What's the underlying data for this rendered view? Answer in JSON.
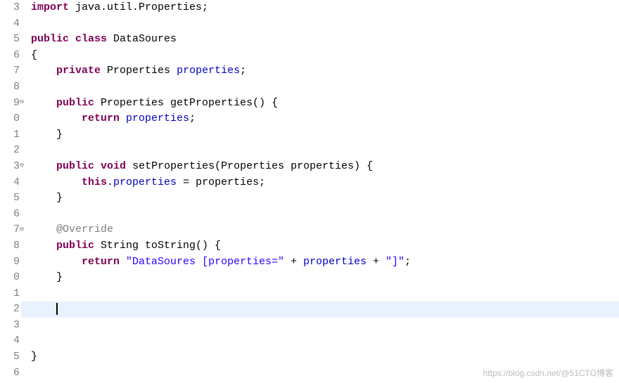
{
  "chart_data": null,
  "gutter": {
    "line_numbers": [
      "3",
      "4",
      "5",
      "6",
      "7",
      "8",
      "9",
      "0",
      "1",
      "2",
      "3",
      "4",
      "5",
      "6",
      "7",
      "8",
      "9",
      "0",
      "1",
      "2",
      "3",
      "4",
      "5",
      "6"
    ],
    "markers": {
      "9": "⊖",
      "13": "⊖",
      "17": "⊖"
    }
  },
  "code": [
    [
      [
        "kw",
        "import"
      ],
      [
        "plain",
        " java.util.Properties;"
      ]
    ],
    [
      [
        "plain",
        ""
      ]
    ],
    [
      [
        "kw",
        "public"
      ],
      [
        "plain",
        " "
      ],
      [
        "kw",
        "class"
      ],
      [
        "plain",
        " DataSoures"
      ]
    ],
    [
      [
        "plain",
        "{"
      ]
    ],
    [
      [
        "plain",
        "    "
      ],
      [
        "kw",
        "private"
      ],
      [
        "plain",
        " Properties "
      ],
      [
        "field",
        "properties"
      ],
      [
        "plain",
        ";"
      ]
    ],
    [
      [
        "plain",
        ""
      ]
    ],
    [
      [
        "plain",
        "    "
      ],
      [
        "kw",
        "public"
      ],
      [
        "plain",
        " Properties getProperties() {"
      ]
    ],
    [
      [
        "plain",
        "        "
      ],
      [
        "kw",
        "return"
      ],
      [
        "plain",
        " "
      ],
      [
        "field",
        "properties"
      ],
      [
        "plain",
        ";"
      ]
    ],
    [
      [
        "plain",
        "    }"
      ]
    ],
    [
      [
        "plain",
        ""
      ]
    ],
    [
      [
        "plain",
        "    "
      ],
      [
        "kw",
        "public"
      ],
      [
        "plain",
        " "
      ],
      [
        "kw",
        "void"
      ],
      [
        "plain",
        " setProperties(Properties properties) {"
      ]
    ],
    [
      [
        "plain",
        "        "
      ],
      [
        "kw",
        "this"
      ],
      [
        "plain",
        "."
      ],
      [
        "field",
        "properties"
      ],
      [
        "plain",
        " = properties;"
      ]
    ],
    [
      [
        "plain",
        "    }"
      ]
    ],
    [
      [
        "plain",
        ""
      ]
    ],
    [
      [
        "plain",
        "    "
      ],
      [
        "anno",
        "@Override"
      ]
    ],
    [
      [
        "plain",
        "    "
      ],
      [
        "kw",
        "public"
      ],
      [
        "plain",
        " String toString() {"
      ]
    ],
    [
      [
        "plain",
        "        "
      ],
      [
        "kw",
        "return"
      ],
      [
        "plain",
        " "
      ],
      [
        "str",
        "\"DataSoures [properties=\""
      ],
      [
        "plain",
        " + "
      ],
      [
        "field",
        "properties"
      ],
      [
        "plain",
        " + "
      ],
      [
        "str",
        "\"]\""
      ],
      [
        "plain",
        ";"
      ]
    ],
    [
      [
        "plain",
        "    }"
      ]
    ],
    [
      [
        "plain",
        ""
      ]
    ],
    [
      [
        "cursor",
        "    "
      ]
    ],
    [
      [
        "plain",
        ""
      ]
    ],
    [
      [
        "plain",
        ""
      ]
    ],
    [
      [
        "plain",
        "}"
      ]
    ],
    [
      [
        "plain",
        ""
      ]
    ]
  ],
  "current_line_index": 19,
  "watermark": "https://blog.csdn.net/@51CTO博客"
}
